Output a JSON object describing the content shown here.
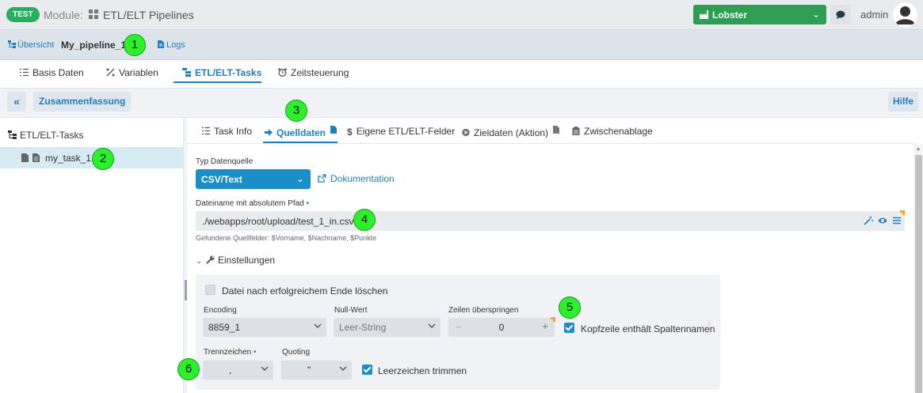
{
  "header": {
    "env_badge": "TEST",
    "module_label": "Module:",
    "module_name": "ETL/ELT Pipelines",
    "tenant_select": "Lobster",
    "user": "admin"
  },
  "breadcrumb": {
    "overview": "Übersicht",
    "pipeline": "My_pipeline_1",
    "logs": "Logs"
  },
  "main_tabs": [
    {
      "label": "Basis Daten",
      "icon": "list-icon"
    },
    {
      "label": "Variablen",
      "icon": "percent-icon"
    },
    {
      "label": "ETL/ELT-Tasks",
      "icon": "tasks-icon",
      "active": true
    },
    {
      "label": "Zeitsteuerung",
      "icon": "alarm-clock-icon"
    }
  ],
  "toolbar": {
    "collapse": "«",
    "summary": "Zusammenfassung",
    "help": "Hilfe"
  },
  "tree": {
    "root": "ETL/ELT-Tasks",
    "items": [
      {
        "label": "my_task_1",
        "selected": true
      }
    ]
  },
  "sub_tabs": [
    {
      "label": "Task Info",
      "icon": "list-icon"
    },
    {
      "label": "Quelldaten",
      "icon": "arrow-right-icon",
      "active": true
    },
    {
      "label": "Eigene ETL/ELT-Felder",
      "icon": "dollar-icon"
    },
    {
      "label": "Zieldaten (Aktion)",
      "icon": "play-circle-icon"
    },
    {
      "label": "Zwischenablage",
      "icon": "clipboard-icon"
    }
  ],
  "source": {
    "type_label": "Typ Datenquelle",
    "type_value": "CSV/Text",
    "doc_link": "Dokumentation",
    "path_label": "Dateiname mit absolutem Pfad",
    "required_mark": "•",
    "path_value": "./webapps/root/upload/test_1_in.csv",
    "found_fields": "Gefundene Quellfelder: $Vorname, $Nachname, $Punkte"
  },
  "settings": {
    "toggle_label": "Einstellungen",
    "delete_after": {
      "label": "Datei nach erfolgreichem Ende löschen",
      "checked": false
    },
    "encoding": {
      "label": "Encoding",
      "value": "8859_1"
    },
    "null_value": {
      "label": "Null-Wert",
      "value": "Leer-String"
    },
    "skip_lines": {
      "label": "Zeilen überspringen",
      "value": "0",
      "minus": "−",
      "plus": "+"
    },
    "header_row": {
      "label": "Kopfzeile enthält Spaltennamen",
      "checked": true
    },
    "separator": {
      "label": "Trennzeichen",
      "value": ","
    },
    "quoting": {
      "label": "Quoting",
      "value": "\""
    },
    "trim": {
      "label": "Leerzeichen trimmen",
      "checked": true
    },
    "info_mark": "i"
  },
  "markers": [
    "1",
    "2",
    "3",
    "4",
    "5",
    "6"
  ],
  "colors": {
    "accent": "#1f7fbf",
    "test_badge": "#27ae60",
    "tenant_select": "#2e9e52",
    "marker": "#2cf02c"
  }
}
